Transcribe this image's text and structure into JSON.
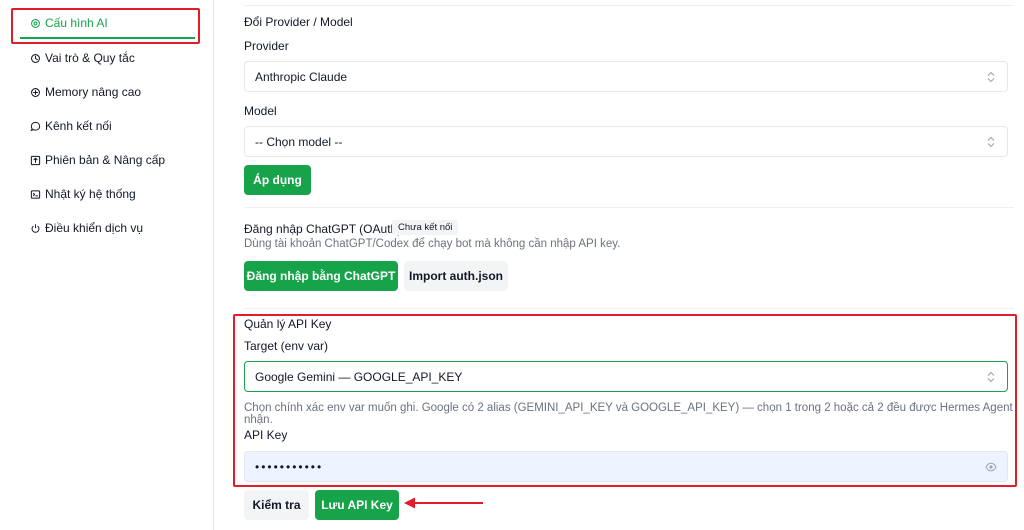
{
  "sidebar": {
    "items": [
      {
        "label": "Cấu hình AI",
        "icon": "gear-icon",
        "active": true
      },
      {
        "label": "Vai trò & Quy tắc",
        "icon": "role-icon"
      },
      {
        "label": "Memory nâng cao",
        "icon": "memory-icon"
      },
      {
        "label": "Kênh kết nối",
        "icon": "chat-bubble-icon"
      },
      {
        "label": "Phiên bản & Nâng cấp",
        "icon": "upgrade-icon"
      },
      {
        "label": "Nhật ký hệ thống",
        "icon": "terminal-icon"
      },
      {
        "label": "Điều khiển dịch vụ",
        "icon": "power-icon"
      }
    ]
  },
  "provider_section": {
    "title": "Đổi Provider / Model",
    "provider_label": "Provider",
    "provider_value": "Anthropic Claude",
    "model_label": "Model",
    "model_value": "-- Chọn model --",
    "apply_label": "Áp dụng"
  },
  "oauth_section": {
    "title": "Đăng nhập ChatGPT (OAuth)",
    "status_badge": "Chưa kết nối",
    "description": "Dùng tài khoản ChatGPT/Codex để chạy bot mà không cần nhập API key.",
    "login_label": "Đăng nhập bằng ChatGPT",
    "import_label": "Import auth.json"
  },
  "api_key_section": {
    "title": "Quản lý API Key",
    "target_label": "Target (env var)",
    "target_value": "Google Gemini — GOOGLE_API_KEY",
    "hint": "Chọn chính xác env var muốn ghi. Google có 2 alias (GEMINI_API_KEY và GOOGLE_API_KEY) — chọn 1 trong 2 hoặc cả 2 đều được Hermes Agent nhận.",
    "key_label": "API Key",
    "key_value": "•••••••••••",
    "check_label": "Kiểm tra",
    "save_label": "Lưu API Key"
  },
  "colors": {
    "accent": "#16a34a",
    "highlight": "#e11d2a"
  }
}
